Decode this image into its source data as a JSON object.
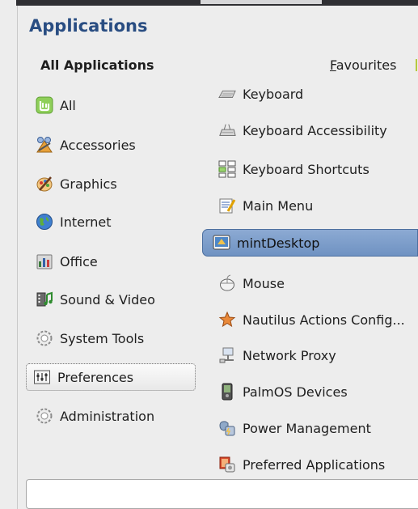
{
  "title": "Applications",
  "all_applications_label": "All Applications",
  "favourites_label": "Favourites",
  "categories": [
    {
      "label": "All",
      "icon": "mint-logo-icon"
    },
    {
      "label": "Accessories",
      "icon": "accessories-icon"
    },
    {
      "label": "Graphics",
      "icon": "graphics-icon"
    },
    {
      "label": "Internet",
      "icon": "internet-globe-icon"
    },
    {
      "label": "Office",
      "icon": "office-icon"
    },
    {
      "label": "Sound & Video",
      "icon": "sound-video-icon"
    },
    {
      "label": "System Tools",
      "icon": "system-tools-icon"
    },
    {
      "label": "Preferences",
      "icon": "preferences-icon",
      "selected": true
    },
    {
      "label": "Administration",
      "icon": "administration-icon"
    }
  ],
  "applications": [
    {
      "label": "Keyboard",
      "icon": "keyboard-icon"
    },
    {
      "label": "Keyboard Accessibility",
      "icon": "keyboard-accessibility-icon"
    },
    {
      "label": "Keyboard Shortcuts",
      "icon": "keyboard-shortcuts-icon"
    },
    {
      "label": "Main Menu",
      "icon": "main-menu-icon"
    },
    {
      "label": "mintDesktop",
      "icon": "mintdesktop-icon",
      "selected": true
    },
    {
      "label": "Mouse",
      "icon": "mouse-icon"
    },
    {
      "label": "Nautilus Actions Config...",
      "icon": "nautilus-actions-icon"
    },
    {
      "label": "Network Proxy",
      "icon": "network-proxy-icon"
    },
    {
      "label": "PalmOS Devices",
      "icon": "palmos-icon"
    },
    {
      "label": "Power Management",
      "icon": "power-management-icon"
    },
    {
      "label": "Preferred Applications",
      "icon": "preferred-applications-icon"
    }
  ],
  "search": {
    "value": "",
    "placeholder": ""
  },
  "colors": {
    "title": "#294d82",
    "selection": "#7b9cc9",
    "accent": "#b7c93f"
  }
}
